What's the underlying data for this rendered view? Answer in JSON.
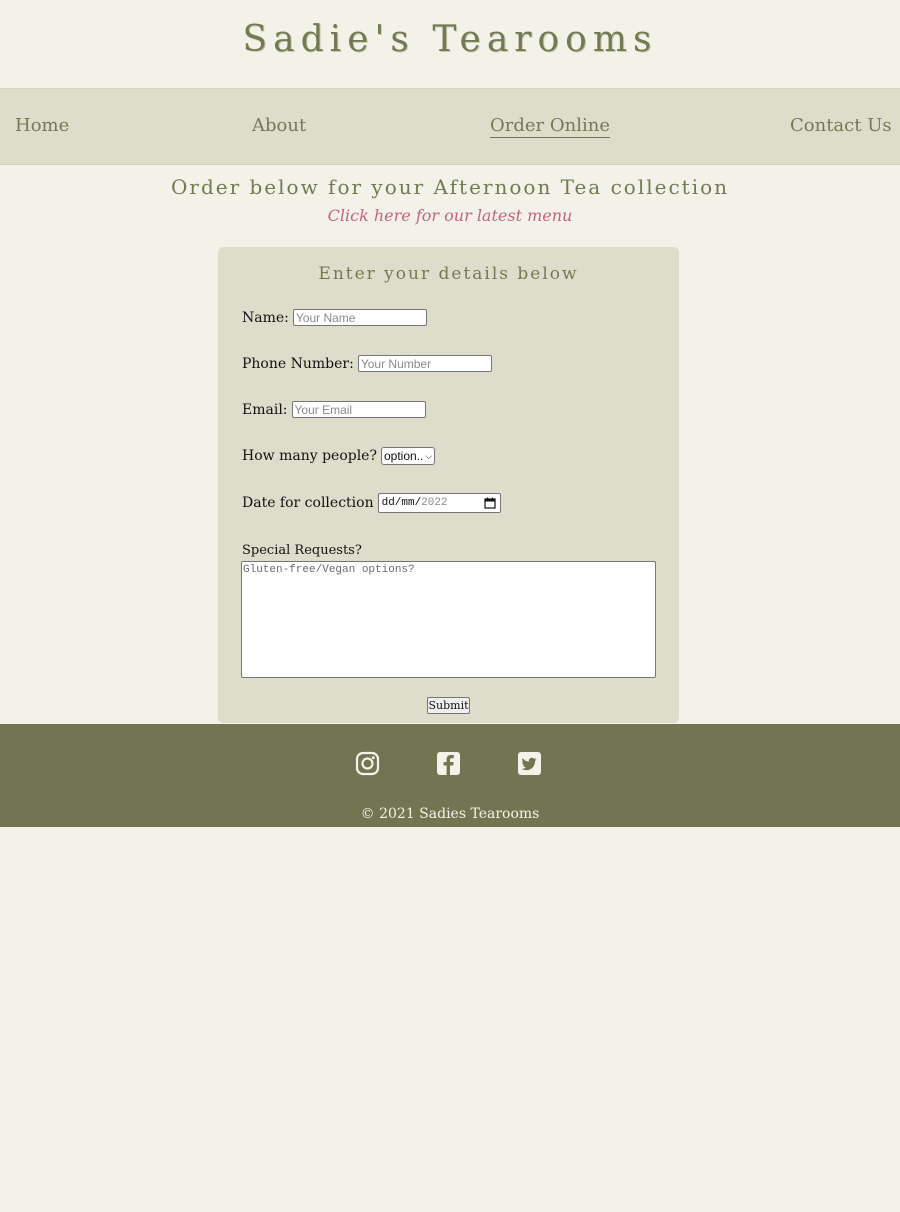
{
  "site": {
    "title": "Sadie's Tearooms"
  },
  "nav": {
    "items": [
      {
        "label": "Home"
      },
      {
        "label": "About"
      },
      {
        "label": "Order Online",
        "active": true
      },
      {
        "label": "Contact Us"
      }
    ]
  },
  "intro": {
    "heading": "Order below for your Afternoon Tea collection",
    "menu_link": "Click here for our latest menu"
  },
  "form": {
    "heading": "Enter your details below",
    "name": {
      "label": "Name:",
      "placeholder": "Your Name",
      "value": ""
    },
    "phone": {
      "label": "Phone Number:",
      "placeholder": "Your Number",
      "value": ""
    },
    "email": {
      "label": "Email:",
      "placeholder": "Your Email",
      "value": ""
    },
    "people": {
      "label": "How many people?",
      "selected": "option.."
    },
    "date": {
      "label": "Date for collection",
      "day_month": "dd/mm/",
      "year": "2022"
    },
    "special": {
      "label": "Special Requests?",
      "placeholder": "Gluten-free/Vegan options?"
    },
    "submit_label": "Submit"
  },
  "footer": {
    "icons": [
      "instagram-icon",
      "facebook-icon",
      "twitter-icon"
    ],
    "copyright": "© 2021 Sadies Tearooms"
  },
  "colors": {
    "background": "#f3f2e8",
    "nav_background": "#deddcb",
    "accent_olive": "#737a53",
    "link_pink": "#c4637f",
    "footer_background": "#717552"
  }
}
